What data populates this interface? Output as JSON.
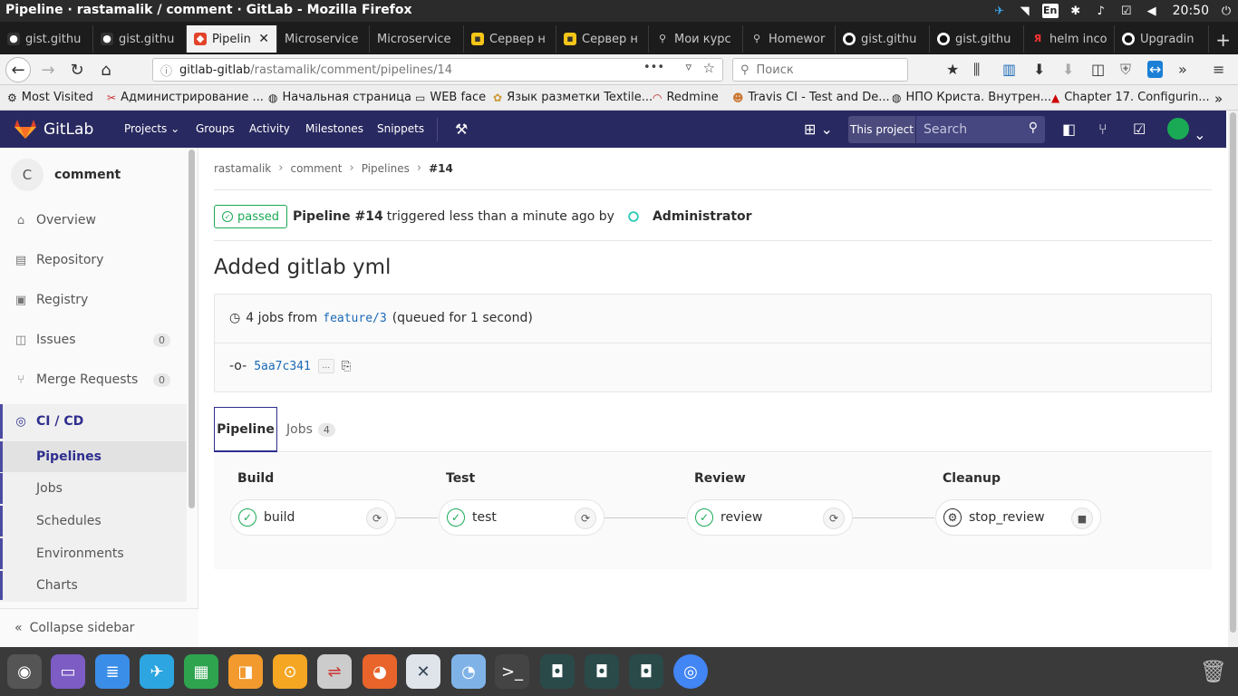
{
  "os": {
    "window_title": "Pipeline · rastamalik / comment · GitLab - Mozilla Firefox",
    "lang": "En",
    "clock": "20:50"
  },
  "tabs": [
    {
      "label": "gist.githu",
      "active": false
    },
    {
      "label": "gist.githu",
      "active": false
    },
    {
      "label": "Pipelin",
      "active": true
    },
    {
      "label": "Microservice",
      "active": false
    },
    {
      "label": "Microservice",
      "active": false
    },
    {
      "label": "Сервер н",
      "active": false
    },
    {
      "label": "Сервер н",
      "active": false
    },
    {
      "label": "Мои курс",
      "active": false
    },
    {
      "label": "Homewor",
      "active": false
    },
    {
      "label": "gist.githu",
      "active": false
    },
    {
      "label": "gist.githu",
      "active": false
    },
    {
      "label": "helm inco",
      "active": false
    },
    {
      "label": "Upgradin",
      "active": false
    }
  ],
  "nav": {
    "url_host": "gitlab-gitlab",
    "url_path": "/rastamalik/comment/pipelines/14",
    "search_placeholder": "Поиск"
  },
  "bookmarks": [
    "Most Visited",
    "Администрирование ...",
    "Начальная страница",
    "WEB face",
    "Язык разметки Textile...",
    "Redmine",
    "Travis CI - Test and De...",
    "НПО Криста. Внутрен...",
    "Chapter 17. Configurin..."
  ],
  "gitlab": {
    "brand": "GitLab",
    "nav": [
      "Projects",
      "Groups",
      "Activity",
      "Milestones",
      "Snippets"
    ],
    "this_project": "This project",
    "search_placeholder": "Search"
  },
  "sidebar": {
    "avatar_letter": "C",
    "project_name": "comment",
    "items": [
      {
        "label": "Overview",
        "icon": "home-icon"
      },
      {
        "label": "Repository",
        "icon": "doc-icon"
      },
      {
        "label": "Registry",
        "icon": "container-icon"
      },
      {
        "label": "Issues",
        "icon": "issues-icon",
        "count": "0"
      },
      {
        "label": "Merge Requests",
        "icon": "merge-icon",
        "count": "0"
      },
      {
        "label": "CI / CD",
        "icon": "rocket-icon"
      }
    ],
    "sub_items": [
      "Pipelines",
      "Jobs",
      "Schedules",
      "Environments",
      "Charts"
    ],
    "collapse_label": "Collapse sidebar"
  },
  "breadcrumbs": [
    "rastamalik",
    "comment",
    "Pipelines",
    "#14"
  ],
  "pipeline": {
    "status": "passed",
    "id_text": "Pipeline #14",
    "triggered_text": "triggered less than a minute ago by",
    "user": "Administrator",
    "commit_title": "Added gitlab yml",
    "jobs_prefix": "4 jobs from",
    "branch": "feature/3",
    "queued_text": "(queued for 1 second)",
    "sha": "5aa7c341",
    "ellipsis": "..."
  },
  "page_tabs": {
    "pipeline": "Pipeline",
    "jobs": "Jobs",
    "jobs_count": "4"
  },
  "stages": [
    {
      "name": "Build",
      "job": "build",
      "status": "success"
    },
    {
      "name": "Test",
      "job": "test",
      "status": "success"
    },
    {
      "name": "Review",
      "job": "review",
      "status": "success"
    },
    {
      "name": "Cleanup",
      "job": "stop_review",
      "status": "manual"
    }
  ],
  "colors": {
    "header_bg": "#292961",
    "success": "#1aaa55",
    "link": "#1b69b6"
  }
}
